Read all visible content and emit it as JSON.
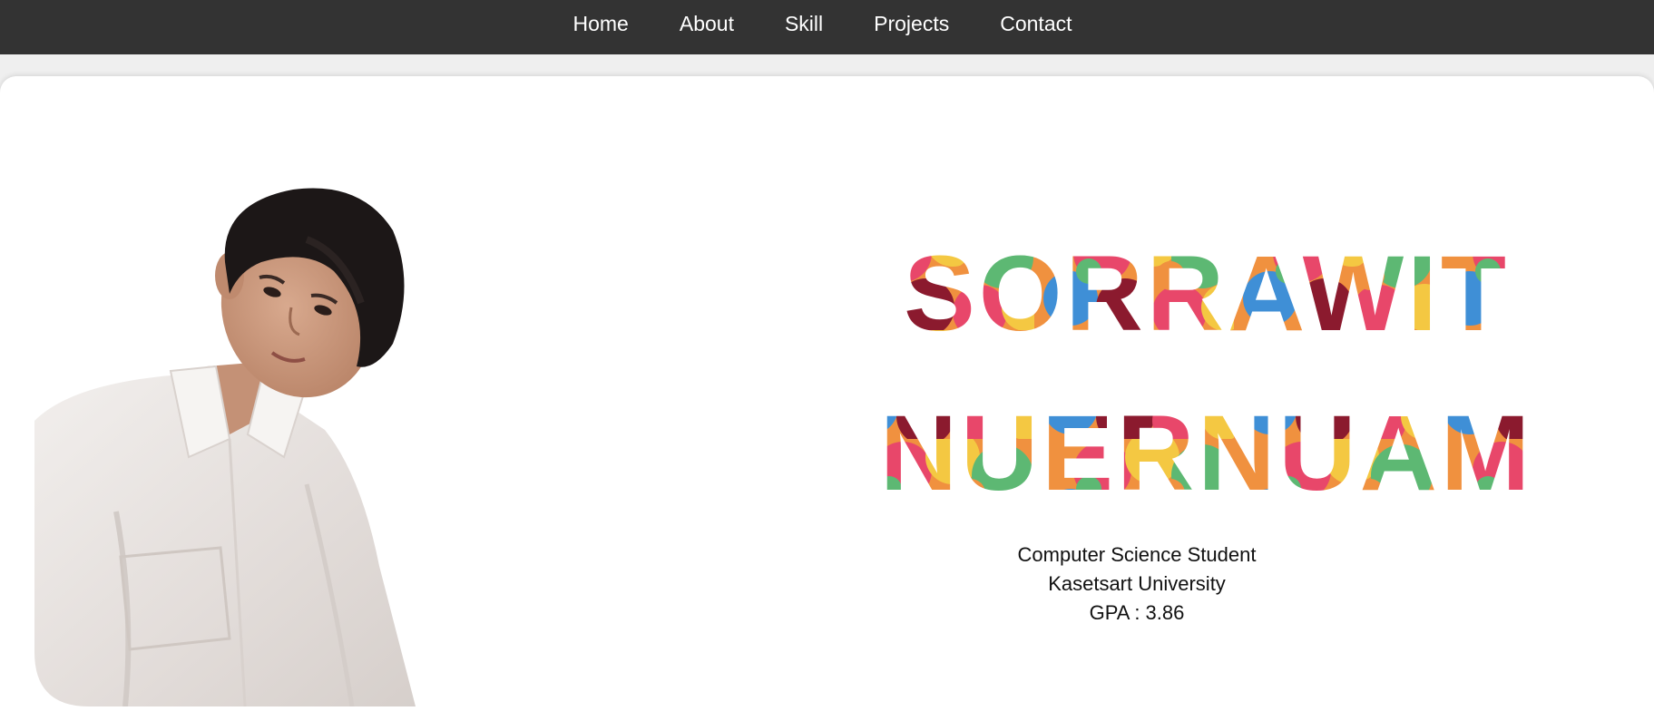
{
  "nav": {
    "items": [
      {
        "label": "Home"
      },
      {
        "label": "About"
      },
      {
        "label": "Skill"
      },
      {
        "label": "Projects"
      },
      {
        "label": "Contact"
      }
    ]
  },
  "hero": {
    "first_name": "SORRAWIT",
    "last_name": "NUERNUAM",
    "role": "Computer Science Student",
    "university": "Kasetsart University",
    "gpa": "GPA : 3.86"
  },
  "colors": {
    "nav_bg": "#333333",
    "page_bg": "#efefef",
    "card_bg": "#ffffff",
    "candy": [
      "#f0913f",
      "#e8476a",
      "#5db873",
      "#f4c842",
      "#3f8fd6",
      "#8b1a2e"
    ]
  }
}
